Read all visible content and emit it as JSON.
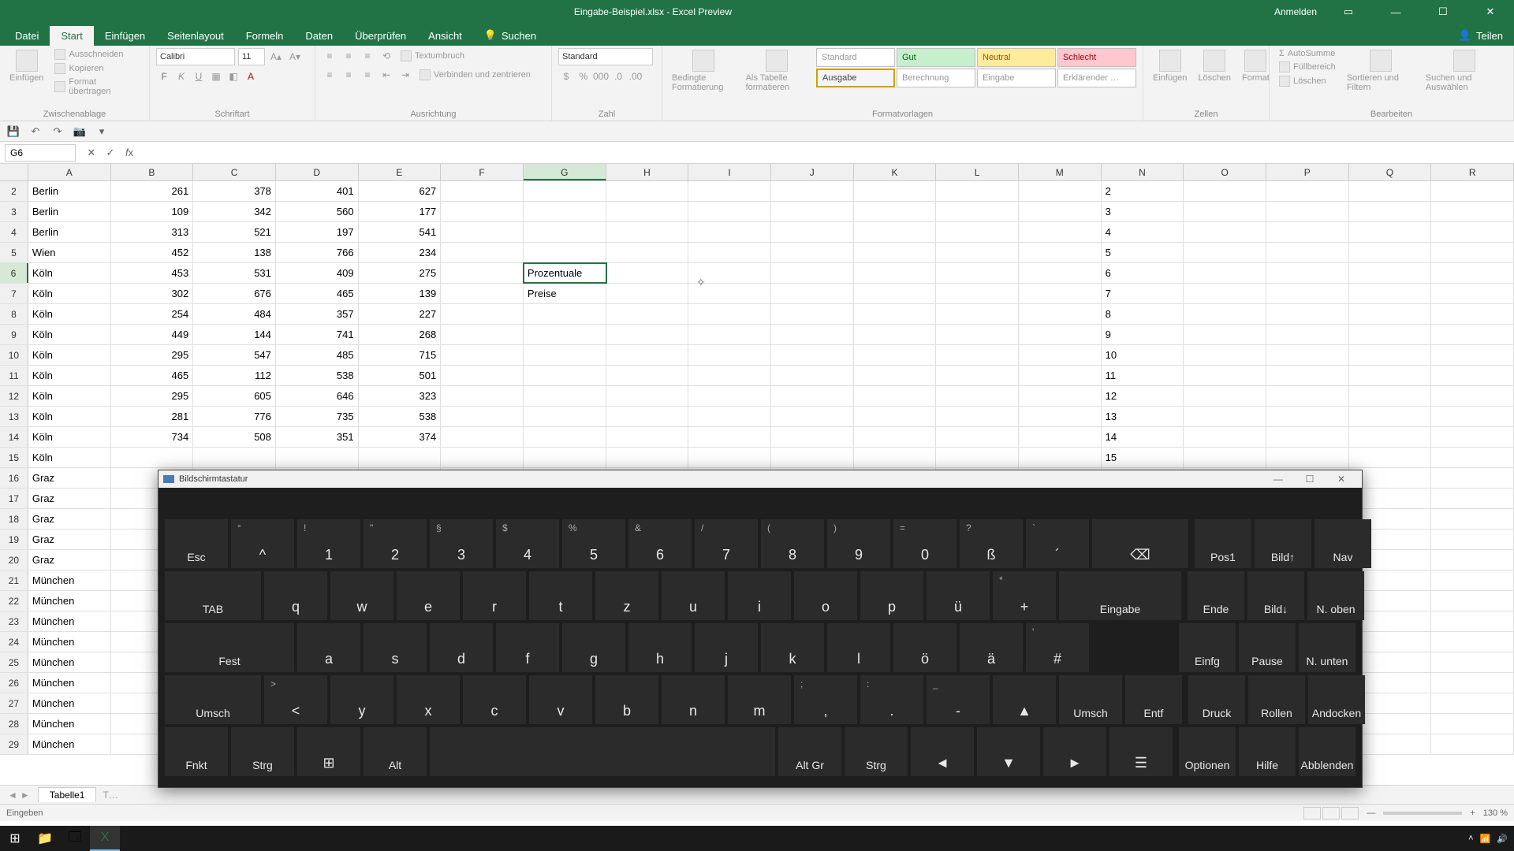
{
  "title": "Eingabe-Beispiel.xlsx - Excel Preview",
  "signin": "Anmelden",
  "share": "Teilen",
  "tabs": {
    "datei": "Datei",
    "start": "Start",
    "einfuegen": "Einfügen",
    "seitenlayout": "Seitenlayout",
    "formeln": "Formeln",
    "daten": "Daten",
    "ueberpruefen": "Überprüfen",
    "ansicht": "Ansicht",
    "suchen": "Suchen"
  },
  "ribbon": {
    "paste": "Einfügen",
    "cut": "Ausschneiden",
    "copy": "Kopieren",
    "format_painter": "Format übertragen",
    "clipboard_label": "Zwischenablage",
    "font_name": "Calibri",
    "font_size": "11",
    "font_label": "Schriftart",
    "align_label": "Ausrichtung",
    "wrap": "Textumbruch",
    "merge": "Verbinden und zentrieren",
    "number_format": "Standard",
    "number_label": "Zahl",
    "cond_fmt": "Bedingte Formatierung",
    "as_table": "Als Tabelle formatieren",
    "styles_label": "Formatvorlagen",
    "style_standard": "Standard",
    "style_gut": "Gut",
    "style_neutral": "Neutral",
    "style_schlecht": "Schlecht",
    "style_ausgabe": "Ausgabe",
    "style_berechnung": "Berechnung",
    "style_eingabe": "Eingabe",
    "style_erklaerend": "Erklärender …",
    "insert": "Einfügen",
    "delete": "Löschen",
    "format": "Format",
    "cells_label": "Zellen",
    "autosum": "AutoSumme",
    "fill": "Füllbereich",
    "clear": "Löschen",
    "sort": "Sortieren und Filtern",
    "find": "Suchen und Auswählen",
    "edit_label": "Bearbeiten"
  },
  "namebox": "G6",
  "columns": [
    "A",
    "B",
    "C",
    "D",
    "E",
    "F",
    "G",
    "H",
    "I",
    "J",
    "K",
    "L",
    "M",
    "N",
    "O",
    "P",
    "Q",
    "R"
  ],
  "rows": [
    {
      "n": 2,
      "a": "Berlin",
      "b": "261",
      "c": "378",
      "d": "401",
      "e": "627",
      "g": ""
    },
    {
      "n": 3,
      "a": "Berlin",
      "b": "109",
      "c": "342",
      "d": "560",
      "e": "177",
      "g": ""
    },
    {
      "n": 4,
      "a": "Berlin",
      "b": "313",
      "c": "521",
      "d": "197",
      "e": "541",
      "g": ""
    },
    {
      "n": 5,
      "a": "Wien",
      "b": "452",
      "c": "138",
      "d": "766",
      "e": "234",
      "g": ""
    },
    {
      "n": 6,
      "a": "Köln",
      "b": "453",
      "c": "531",
      "d": "409",
      "e": "275",
      "g": "Prozentuale"
    },
    {
      "n": 7,
      "a": "Köln",
      "b": "302",
      "c": "676",
      "d": "465",
      "e": "139",
      "g": "Preise"
    },
    {
      "n": 8,
      "a": "Köln",
      "b": "254",
      "c": "484",
      "d": "357",
      "e": "227",
      "g": ""
    },
    {
      "n": 9,
      "a": "Köln",
      "b": "449",
      "c": "144",
      "d": "741",
      "e": "268",
      "g": ""
    },
    {
      "n": 10,
      "a": "Köln",
      "b": "295",
      "c": "547",
      "d": "485",
      "e": "715",
      "g": ""
    },
    {
      "n": 11,
      "a": "Köln",
      "b": "465",
      "c": "112",
      "d": "538",
      "e": "501",
      "g": ""
    },
    {
      "n": 12,
      "a": "Köln",
      "b": "295",
      "c": "605",
      "d": "646",
      "e": "323",
      "g": ""
    },
    {
      "n": 13,
      "a": "Köln",
      "b": "281",
      "c": "776",
      "d": "735",
      "e": "538",
      "g": ""
    },
    {
      "n": 14,
      "a": "Köln",
      "b": "734",
      "c": "508",
      "d": "351",
      "e": "374",
      "g": ""
    },
    {
      "n": 15,
      "a": "Köln",
      "b": "",
      "c": "",
      "d": "",
      "e": "",
      "g": ""
    },
    {
      "n": 16,
      "a": "Graz",
      "b": "",
      "c": "",
      "d": "",
      "e": "",
      "g": ""
    },
    {
      "n": 17,
      "a": "Graz",
      "b": "",
      "c": "",
      "d": "",
      "e": "",
      "g": ""
    },
    {
      "n": 18,
      "a": "Graz",
      "b": "",
      "c": "",
      "d": "",
      "e": "",
      "g": ""
    },
    {
      "n": 19,
      "a": "Graz",
      "b": "",
      "c": "",
      "d": "",
      "e": "",
      "g": ""
    },
    {
      "n": 20,
      "a": "Graz",
      "b": "",
      "c": "",
      "d": "",
      "e": "",
      "g": ""
    },
    {
      "n": 21,
      "a": "München",
      "b": "",
      "c": "",
      "d": "",
      "e": "",
      "g": ""
    },
    {
      "n": 22,
      "a": "München",
      "b": "",
      "c": "",
      "d": "",
      "e": "",
      "g": ""
    },
    {
      "n": 23,
      "a": "München",
      "b": "",
      "c": "",
      "d": "",
      "e": "",
      "g": ""
    },
    {
      "n": 24,
      "a": "München",
      "b": "",
      "c": "",
      "d": "",
      "e": "",
      "g": ""
    },
    {
      "n": 25,
      "a": "München",
      "b": "",
      "c": "",
      "d": "",
      "e": "",
      "g": ""
    },
    {
      "n": 26,
      "a": "München",
      "b": "",
      "c": "",
      "d": "",
      "e": "",
      "g": ""
    },
    {
      "n": 27,
      "a": "München",
      "b": "",
      "c": "",
      "d": "",
      "e": "",
      "g": ""
    },
    {
      "n": 28,
      "a": "München",
      "b": "",
      "c": "",
      "d": "",
      "e": "",
      "g": ""
    },
    {
      "n": 29,
      "a": "München",
      "b": "",
      "c": "",
      "d": "",
      "e": "",
      "g": ""
    }
  ],
  "sheet": "Tabelle1",
  "status": "Eingeben",
  "zoom": "130 %",
  "osk": {
    "title": "Bildschirmtastatur",
    "row1": [
      "Esc",
      "^",
      "1",
      "2",
      "3",
      "4",
      "5",
      "6",
      "7",
      "8",
      "9",
      "0",
      "ß",
      "´",
      "⌫"
    ],
    "row1_sup": [
      "",
      "°",
      "!",
      "\"",
      "§",
      "$",
      "%",
      "&",
      "/",
      "(",
      ")",
      "=",
      "?",
      "`",
      ""
    ],
    "row2": [
      "TAB",
      "q",
      "w",
      "e",
      "r",
      "t",
      "z",
      "u",
      "i",
      "o",
      "p",
      "ü",
      "+",
      "Eingabe"
    ],
    "row2_sup": [
      "",
      "",
      "",
      "",
      "",
      "",
      "",
      "",
      "",
      "",
      "",
      "",
      "*",
      ""
    ],
    "row3": [
      "Fest",
      "a",
      "s",
      "d",
      "f",
      "g",
      "h",
      "j",
      "k",
      "l",
      "ö",
      "ä",
      "#"
    ],
    "row3_sup": [
      "",
      "",
      "",
      "",
      "",
      "",
      "",
      "",
      "",
      "",
      "",
      "",
      "'"
    ],
    "row4": [
      "Umsch",
      "<",
      "y",
      "x",
      "c",
      "v",
      "b",
      "n",
      "m",
      ",",
      ".",
      "-",
      "▲",
      "Umsch",
      "Entf"
    ],
    "row4_sup": [
      "",
      ">",
      "",
      "",
      "",
      "",
      "",
      "",
      "",
      ";",
      ":",
      "_",
      "",
      "",
      ""
    ],
    "row5": [
      "Fnkt",
      "Strg",
      "⊞",
      "Alt",
      "",
      "Alt Gr",
      "Strg",
      "◄",
      "▼",
      "►",
      "☰"
    ],
    "nav": [
      "Pos1",
      "Bild↑",
      "Nav",
      "Ende",
      "Bild↓",
      "N. oben",
      "Einfg",
      "Pause",
      "N. unten",
      "Druck",
      "Rollen",
      "Andocken",
      "Optionen",
      "Hilfe",
      "Abblenden"
    ]
  }
}
